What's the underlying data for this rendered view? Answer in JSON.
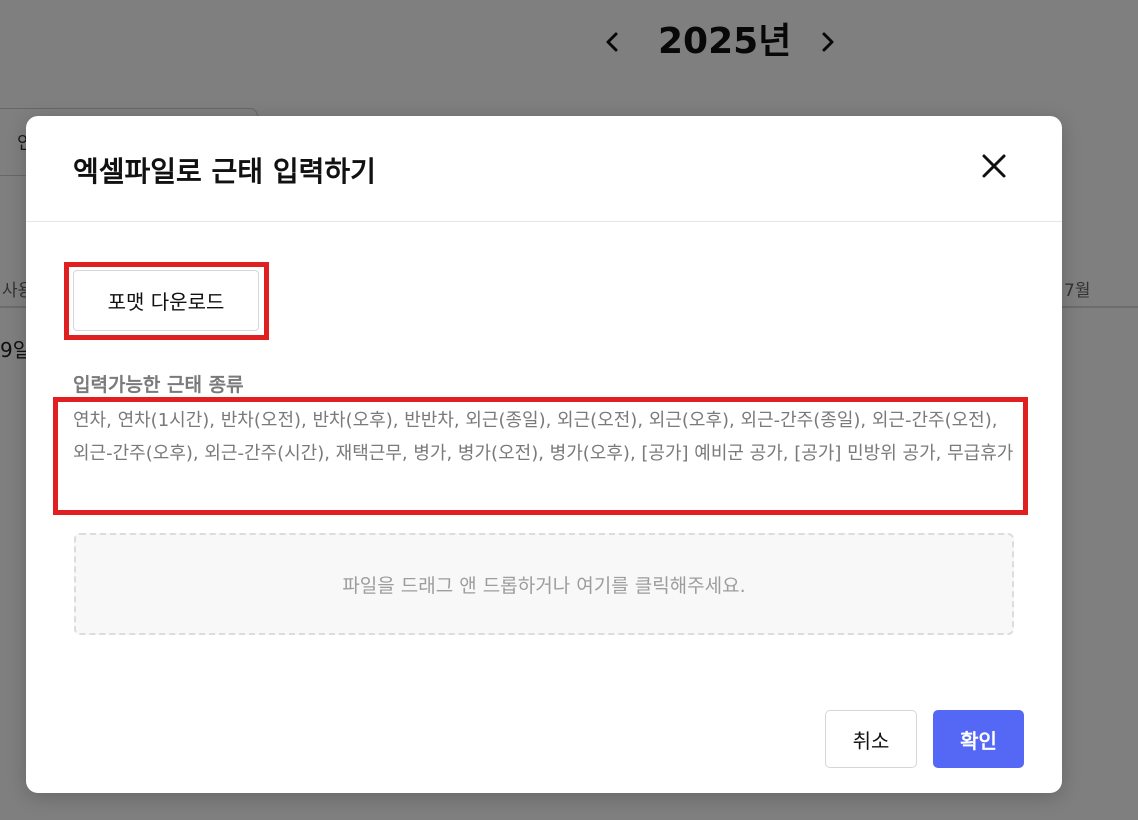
{
  "background": {
    "year_prev_icon": "chevron-left-icon",
    "year_label": "2025년",
    "year_next_icon": "chevron-right-icon",
    "input_partial_text": "인",
    "header_left_partial": "사용",
    "header_right_partial": "7월",
    "row_label_partial": "9일"
  },
  "modal": {
    "title": "엑셀파일로 근태 입력하기",
    "close_icon": "close-icon",
    "download_button_label": "포맷 다운로드",
    "types_section_title": "입력가능한 근태 종류",
    "types_list": "연차, 연차(1시간), 반차(오전), 반차(오후), 반반차, 외근(종일), 외근(오전), 외근(오후), 외근-간주(종일), 외근-간주(오전), 외근-간주(오후), 외근-간주(시간), 재택근무, 병가, 병가(오전), 병가(오후), [공가] 예비군 공가, [공가] 민방위 공가, 무급휴가",
    "dropzone_text": "파일을 드래그 앤 드롭하거나 여기를 클릭해주세요.",
    "cancel_label": "취소",
    "confirm_label": "확인"
  },
  "colors": {
    "overlay": "#00000080",
    "highlight": "#e02020",
    "confirm_button": "#5468f5"
  }
}
